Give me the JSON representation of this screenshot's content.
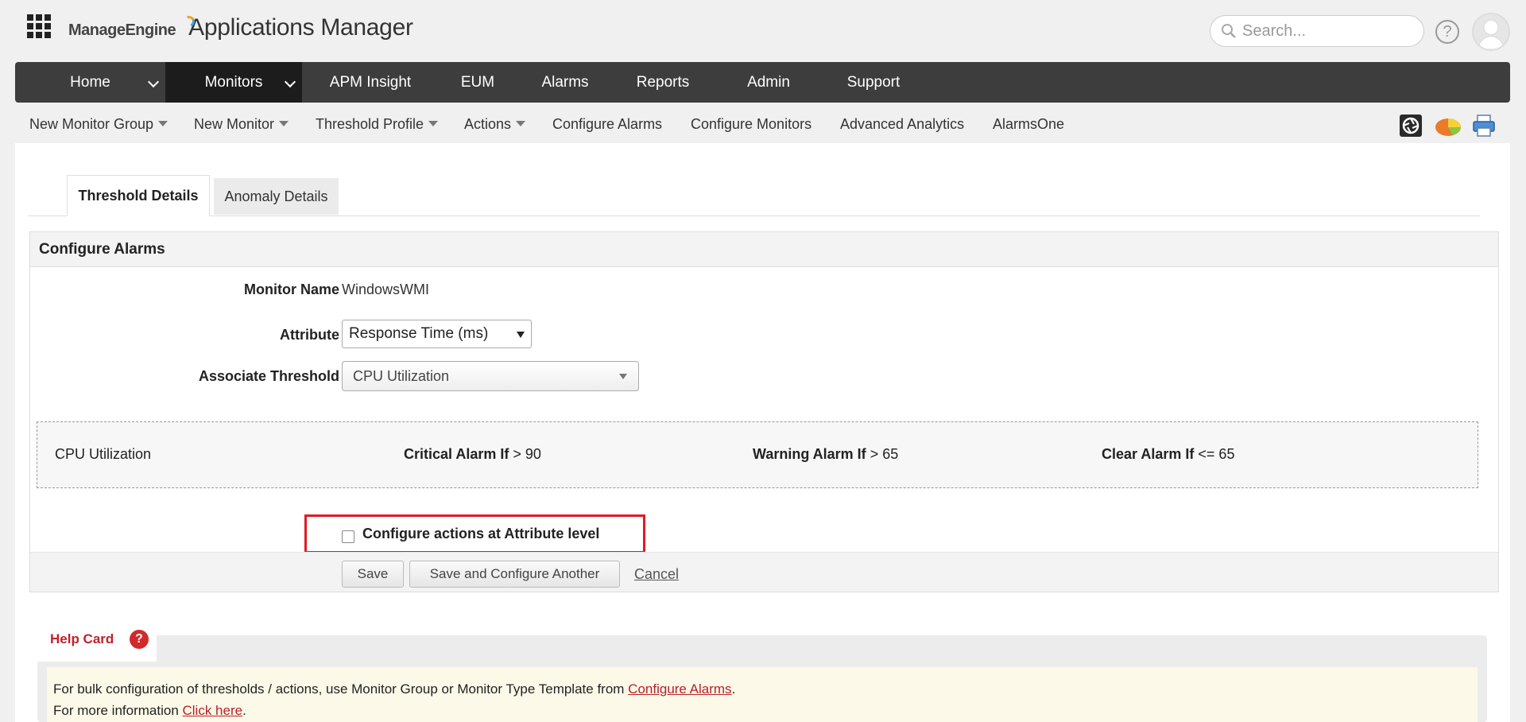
{
  "header": {
    "brand_company": "ManageEngine",
    "brand_product": "Applications Manager",
    "search_placeholder": "Search...",
    "help_symbol": "?"
  },
  "nav": {
    "items": [
      {
        "label": "Home",
        "dropdown": true
      },
      {
        "label": "Monitors",
        "dropdown": true,
        "active": true
      },
      {
        "label": "APM Insight"
      },
      {
        "label": "EUM"
      },
      {
        "label": "Alarms"
      },
      {
        "label": "Reports"
      },
      {
        "label": "Admin"
      },
      {
        "label": "Support"
      }
    ]
  },
  "subbar": {
    "items": [
      {
        "label": "New Monitor Group",
        "dropdown": true
      },
      {
        "label": "New Monitor",
        "dropdown": true
      },
      {
        "label": "Threshold Profile",
        "dropdown": true
      },
      {
        "label": "Actions",
        "dropdown": true
      },
      {
        "label": "Configure Alarms"
      },
      {
        "label": "Configure Monitors"
      },
      {
        "label": "Advanced Analytics"
      },
      {
        "label": "AlarmsOne"
      }
    ],
    "tool_icons": [
      "camera-shutter-icon",
      "pie-chart-icon",
      "printer-icon"
    ]
  },
  "tabs": {
    "active": "Threshold Details",
    "inactive": "Anomaly Details"
  },
  "configure_alarms": {
    "title": "Configure Alarms",
    "monitor_name_label": "Monitor Name",
    "monitor_name_value": "WindowsWMI",
    "attribute_label": "Attribute",
    "attribute_value": "Response Time (ms)",
    "associate_threshold_label": "Associate Threshold",
    "associate_threshold_value": "CPU Utilization",
    "threshold": {
      "name": "CPU Utilization",
      "critical_label": "Critical Alarm If",
      "critical_value": "> 90",
      "warning_label": "Warning Alarm If",
      "warning_value": "> 65",
      "clear_label": "Clear Alarm If",
      "clear_value": "<= 65"
    },
    "checkbox_label": "Configure actions at Attribute level",
    "checkbox_checked": false,
    "buttons": {
      "save": "Save",
      "save_another": "Save and Configure Another",
      "cancel": "Cancel"
    }
  },
  "help_card": {
    "title": "Help Card",
    "icon_symbol": "?",
    "line1_text": "For bulk configuration of thresholds / actions, use Monitor Group or Monitor Type Template from ",
    "line1_link": "Configure Alarms",
    "line1_end": ".",
    "line2_text": "For more information ",
    "line2_link": "Click here",
    "line2_end": "."
  },
  "colors": {
    "nav_bg": "#3d3d3d",
    "nav_active_bg": "#1c1c1c",
    "highlight_border": "#e01b24",
    "help_title": "#c0212b",
    "help_body_bg": "#fdf9e8"
  }
}
